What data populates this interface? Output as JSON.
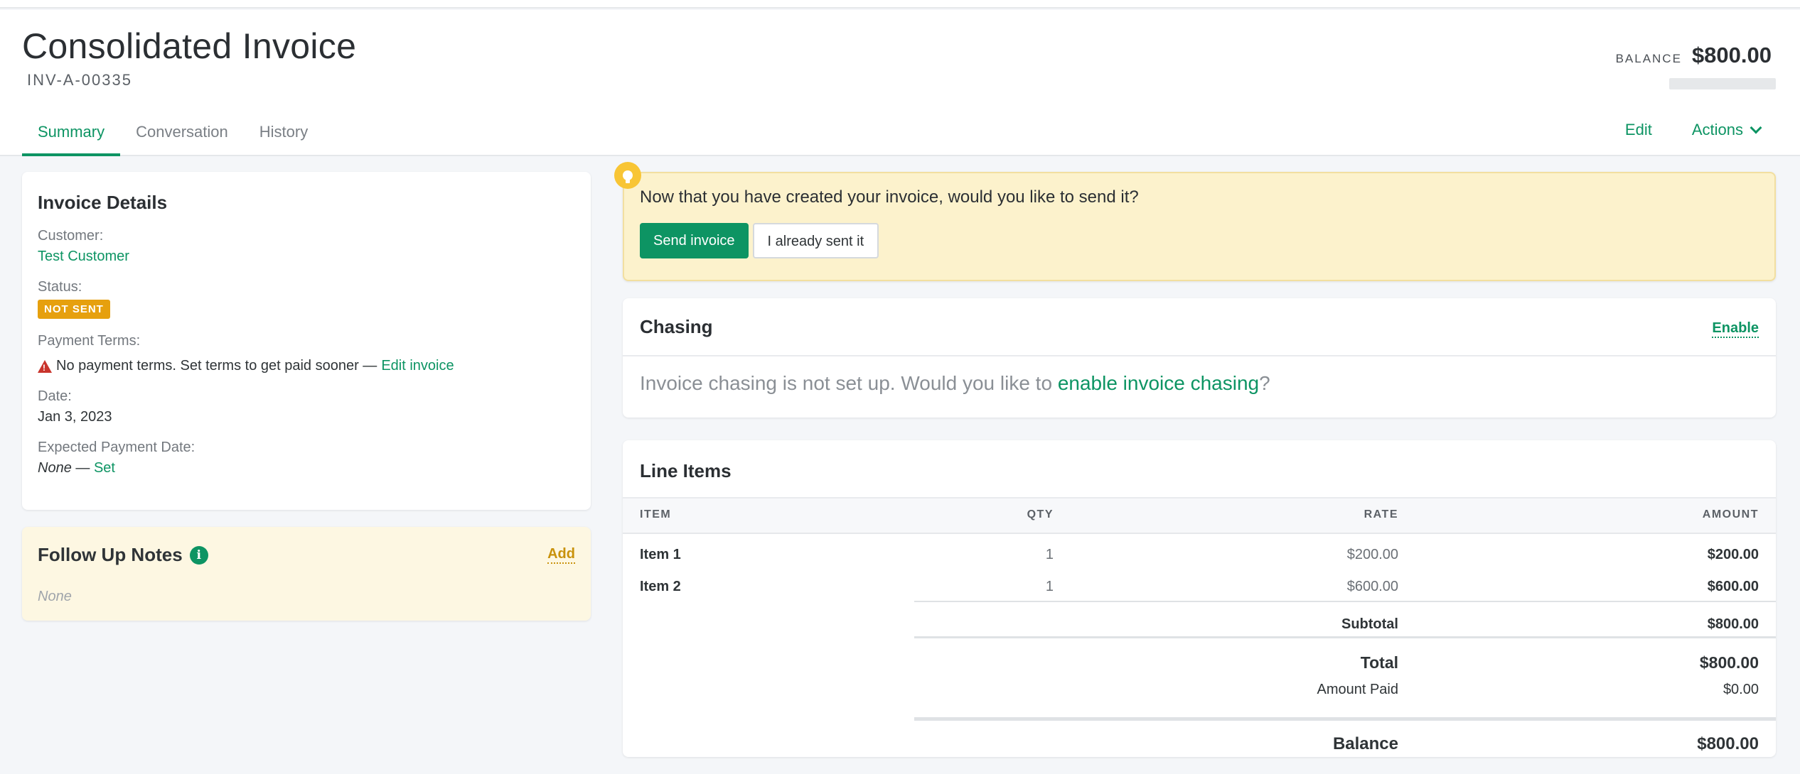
{
  "header": {
    "title": "Consolidated Invoice",
    "invoice_number": "INV-A-00335",
    "balance_label": "BALANCE",
    "balance_value": "$800.00",
    "tabs": [
      {
        "label": "Summary",
        "active": true
      },
      {
        "label": "Conversation",
        "active": false
      },
      {
        "label": "History",
        "active": false
      }
    ],
    "edit_label": "Edit",
    "actions_label": "Actions"
  },
  "details": {
    "title": "Invoice Details",
    "customer_label": "Customer:",
    "customer_value": "Test Customer",
    "status_label": "Status:",
    "status_value": "NOT SENT",
    "terms_label": "Payment Terms:",
    "terms_warning": "No payment terms. Set terms to get paid sooner — ",
    "terms_link": "Edit invoice",
    "date_label": "Date:",
    "date_value": "Jan 3, 2023",
    "expected_label": "Expected Payment Date:",
    "expected_value": "None",
    "expected_sep": " — ",
    "expected_link": "Set"
  },
  "notes": {
    "title": "Follow Up Notes",
    "add_label": "Add",
    "empty": "None"
  },
  "prompt": {
    "text": "Now that you have created your invoice, would you like to send it?",
    "send_label": "Send invoice",
    "already_label": "I already sent it"
  },
  "chasing": {
    "title": "Chasing",
    "enable_label": "Enable",
    "body_prefix": "Invoice chasing is not set up. Would you like to ",
    "body_link": "enable invoice chasing",
    "body_suffix": "?"
  },
  "line_items": {
    "title": "Line Items",
    "columns": {
      "item": "ITEM",
      "qty": "QTY",
      "rate": "RATE",
      "amount": "AMOUNT"
    },
    "rows": [
      {
        "item": "Item 1",
        "qty": "1",
        "rate": "$200.00",
        "amount": "$200.00"
      },
      {
        "item": "Item 2",
        "qty": "1",
        "rate": "$600.00",
        "amount": "$600.00"
      }
    ],
    "subtotal_label": "Subtotal",
    "subtotal_value": "$800.00",
    "total_label": "Total",
    "total_value": "$800.00",
    "paid_label": "Amount Paid",
    "paid_value": "$0.00",
    "balance_label": "Balance",
    "balance_value": "$800.00"
  },
  "colors": {
    "accent": "#0d9463",
    "status_badge": "#e6a00e",
    "prompt_bg": "#fcf2cc",
    "notes_bg": "#fdf7e2",
    "warning": "#c9342c"
  },
  "icons": [
    "warning-icon",
    "info-icon",
    "lightbulb-icon",
    "chevron-down-icon"
  ]
}
